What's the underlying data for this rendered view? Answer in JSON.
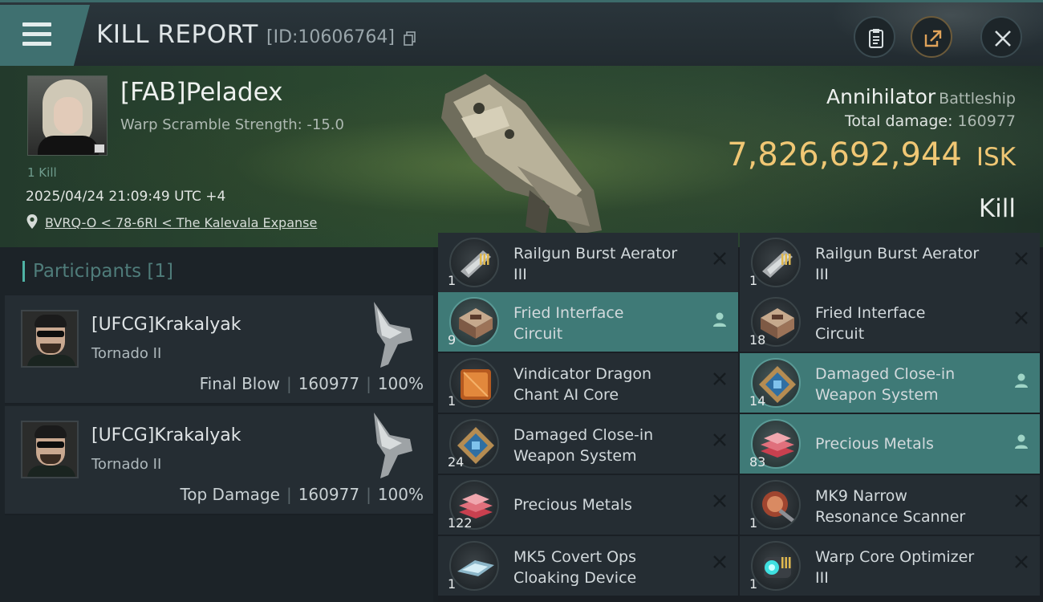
{
  "header": {
    "title": "KILL REPORT",
    "report_id": "[ID:10606764]",
    "buttons": [
      "clipboard-icon",
      "share-icon",
      "close-icon"
    ]
  },
  "victim": {
    "name": "[FAB]Peladex",
    "warp_scramble": "Warp Scramble Strength: -15.0",
    "kill_count": "1 Kill",
    "date": "2025/04/24 21:09:49 UTC +4",
    "location": "BVRQ-O < 78-6RI < The Kalevala Expanse"
  },
  "ship": {
    "name": "Annihilator",
    "class": "Battleship",
    "total_damage_label": "Total damage:",
    "total_damage": "160977",
    "isk_value": "7,826,692,944",
    "isk_unit": "ISK",
    "result": "Kill"
  },
  "participants": {
    "header": "Participants [1]",
    "rows": [
      {
        "name": "[UFCG]Krakalyak",
        "ship": "Tornado II",
        "role": "Final Blow",
        "damage": "160977",
        "percent": "100%"
      },
      {
        "name": "[UFCG]Krakalyak",
        "ship": "Tornado II",
        "role": "Top Damage",
        "damage": "160977",
        "percent": "100%"
      }
    ]
  },
  "items_left": [
    {
      "qty": "1",
      "name": "Railgun Burst Aerator III",
      "highlight": false,
      "icon": "railgun-burst-aerator-icon"
    },
    {
      "qty": "9",
      "name": "Fried Interface Circuit",
      "highlight": true,
      "icon": "fried-interface-circuit-icon"
    },
    {
      "qty": "1",
      "name": "Vindicator Dragon Chant AI Core",
      "highlight": false,
      "icon": "ai-core-icon"
    },
    {
      "qty": "24",
      "name": "Damaged Close-in Weapon System",
      "highlight": false,
      "icon": "weapon-system-icon"
    },
    {
      "qty": "122",
      "name": "Precious Metals",
      "highlight": false,
      "icon": "precious-metals-icon"
    },
    {
      "qty": "1",
      "name": "MK5 Covert Ops Cloaking Device",
      "highlight": false,
      "icon": "cloaking-device-icon"
    }
  ],
  "items_right": [
    {
      "qty": "1",
      "name": "Railgun Burst Aerator III",
      "highlight": false,
      "icon": "railgun-burst-aerator-icon"
    },
    {
      "qty": "18",
      "name": "Fried Interface Circuit",
      "highlight": false,
      "icon": "fried-interface-circuit-icon"
    },
    {
      "qty": "14",
      "name": "Damaged Close-in Weapon System",
      "highlight": true,
      "icon": "weapon-system-icon"
    },
    {
      "qty": "83",
      "name": "Precious Metals",
      "highlight": true,
      "icon": "precious-metals-icon"
    },
    {
      "qty": "1",
      "name": "MK9 Narrow Resonance Scanner",
      "highlight": false,
      "icon": "resonance-scanner-icon"
    },
    {
      "qty": "1",
      "name": "Warp Core Optimizer III",
      "highlight": false,
      "icon": "warp-core-optimizer-icon"
    }
  ],
  "item_name_lines": {
    "l0": [
      "Railgun Burst Aerator",
      "III"
    ],
    "l1": [
      "Fried Interface",
      "Circuit"
    ],
    "l2": [
      "Vindicator Dragon",
      "Chant AI Core"
    ],
    "l3": [
      "Damaged Close-in",
      "Weapon System"
    ],
    "l4": [
      "Precious Metals"
    ],
    "l5": [
      "MK5 Covert Ops",
      "Cloaking Device"
    ],
    "r0": [
      "Railgun Burst Aerator",
      "III"
    ],
    "r1": [
      "Fried Interface",
      "Circuit"
    ],
    "r2": [
      "Damaged Close-in",
      "Weapon System"
    ],
    "r3": [
      "Precious Metals"
    ],
    "r4": [
      "MK9 Narrow",
      "Resonance Scanner"
    ],
    "r5": [
      "Warp Core Optimizer",
      "III"
    ]
  }
}
